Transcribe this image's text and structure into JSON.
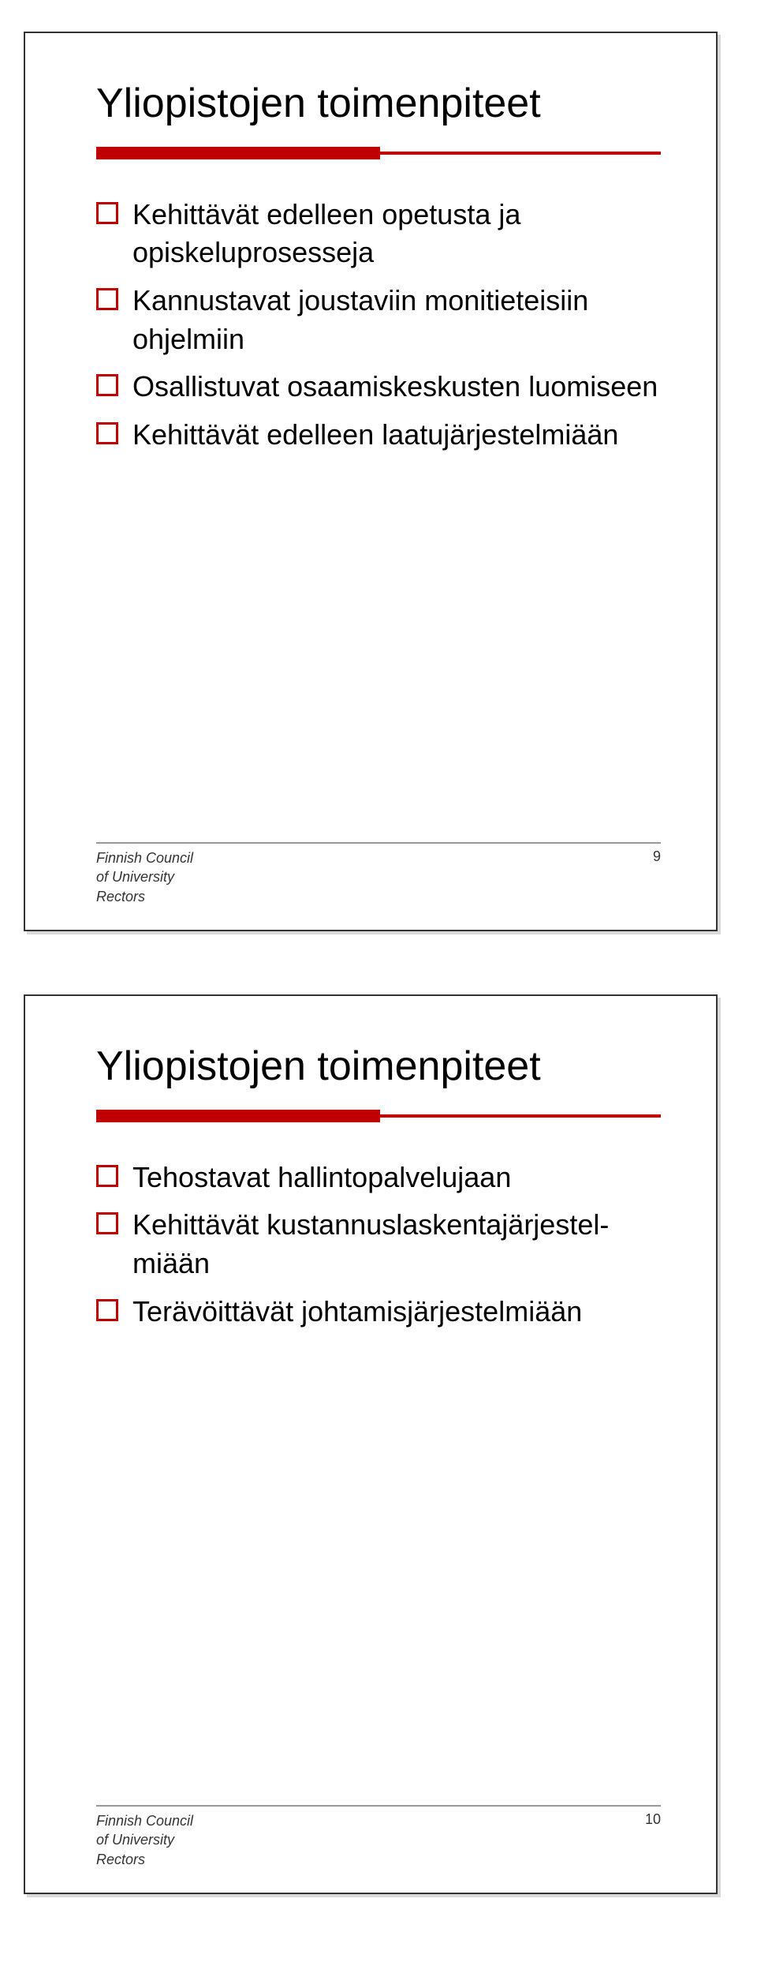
{
  "slides": [
    {
      "title": "Yliopistojen toimenpiteet",
      "bullets": [
        "Kehittävät edelleen opetusta ja opiskeluprosesseja",
        "Kannustavat joustaviin monitieteisiin ohjelmiin",
        "Osallistuvat osaamiskeskusten luomiseen",
        "Kehittävät edelleen laatujärjestelmiään"
      ],
      "footer": {
        "org_line1": "Finnish Council",
        "org_line2": "of University",
        "org_line3": "Rectors",
        "page": "9"
      }
    },
    {
      "title": "Yliopistojen toimenpiteet",
      "bullets": [
        "Tehostavat hallintopalvelujaan",
        "Kehittävät kustannuslaskentajärjestel-miään",
        "Terävöittävät johtamisjärjestelmiään"
      ],
      "footer": {
        "org_line1": "Finnish Council",
        "org_line2": "of University",
        "org_line3": "Rectors",
        "page": "10"
      }
    }
  ]
}
